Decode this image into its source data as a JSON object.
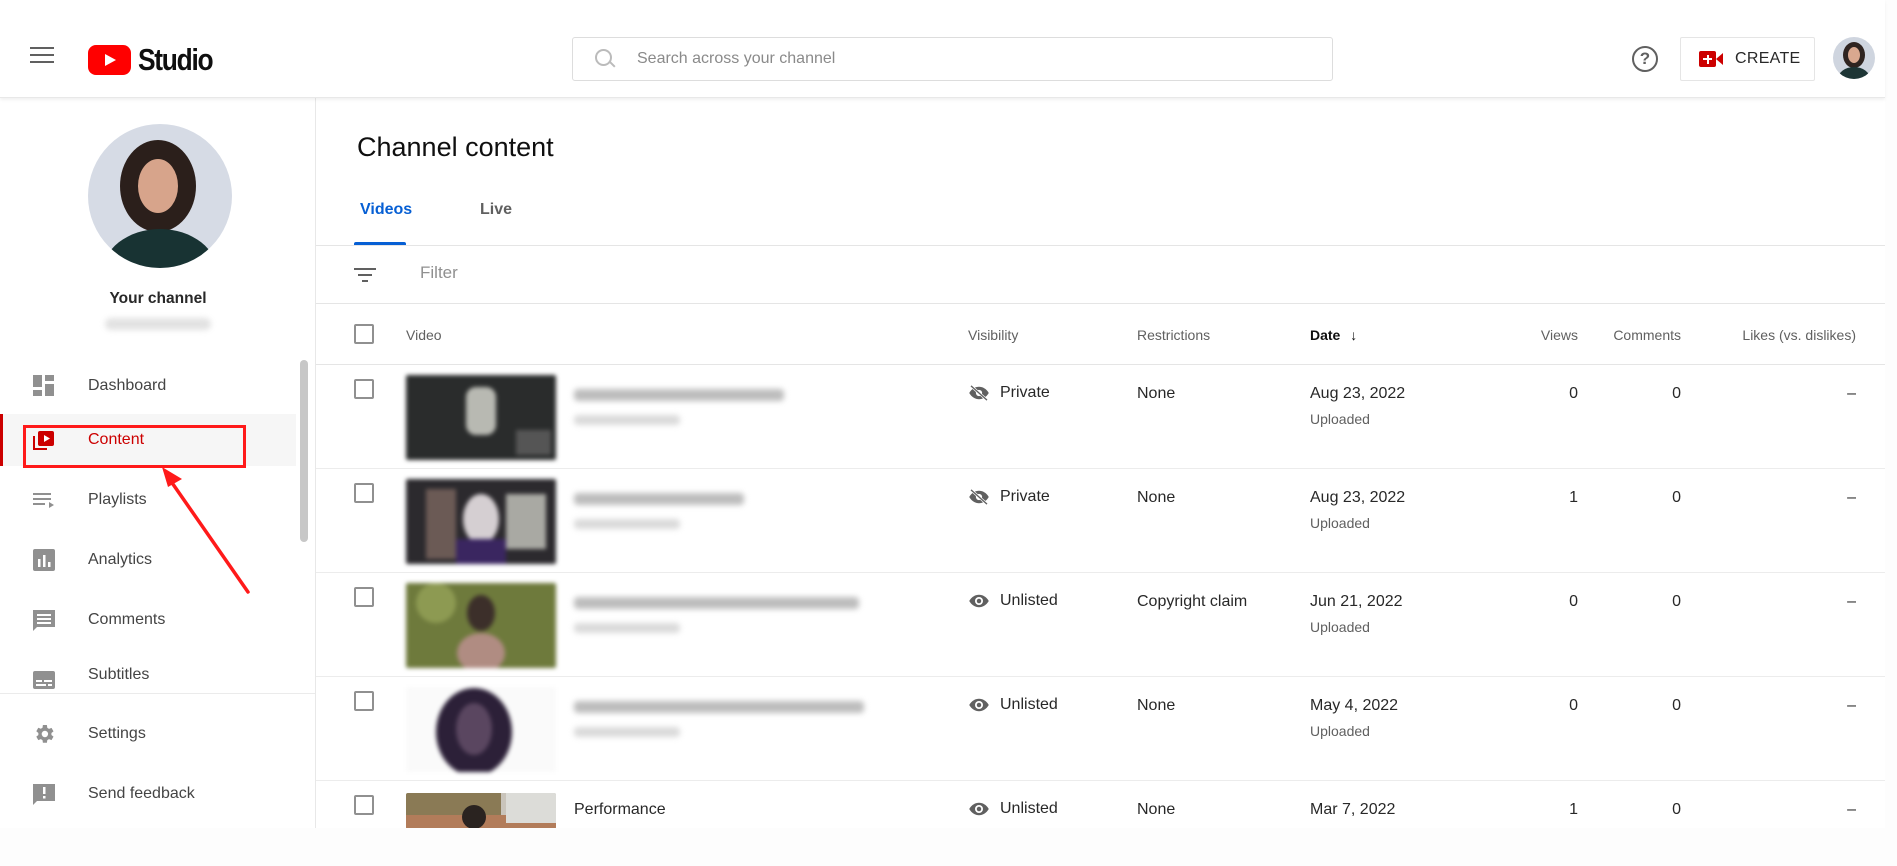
{
  "header": {
    "logo_text": "Studio",
    "search_placeholder": "Search across your channel",
    "help_glyph": "?",
    "create_label": "CREATE"
  },
  "sidebar": {
    "your_channel": "Your channel",
    "items": [
      {
        "label": "Dashboard",
        "icon": "dashboard-icon"
      },
      {
        "label": "Content",
        "icon": "content-icon",
        "active": true
      },
      {
        "label": "Playlists",
        "icon": "playlists-icon"
      },
      {
        "label": "Analytics",
        "icon": "analytics-icon"
      },
      {
        "label": "Comments",
        "icon": "comments-icon"
      },
      {
        "label": "Subtitles",
        "icon": "subtitles-icon"
      }
    ],
    "footer_items": [
      {
        "label": "Settings",
        "icon": "settings-icon"
      },
      {
        "label": "Send feedback",
        "icon": "feedback-icon"
      }
    ]
  },
  "main": {
    "title": "Channel content",
    "tabs": [
      {
        "label": "Videos",
        "active": true
      },
      {
        "label": "Live",
        "active": false
      }
    ],
    "filter_placeholder": "Filter",
    "columns": {
      "video": "Video",
      "visibility": "Visibility",
      "restrictions": "Restrictions",
      "date": "Date",
      "date_sort_glyph": "↓",
      "views": "Views",
      "comments": "Comments",
      "likes": "Likes (vs. dislikes)"
    },
    "rows": [
      {
        "title": "",
        "visibility": "Private",
        "visibility_icon": "eye-off-icon",
        "restrictions": "None",
        "date": "Aug 23, 2022",
        "date_status": "Uploaded",
        "views": "0",
        "comments": "0",
        "likes": "–"
      },
      {
        "title": "",
        "visibility": "Private",
        "visibility_icon": "eye-off-icon",
        "restrictions": "None",
        "date": "Aug 23, 2022",
        "date_status": "Uploaded",
        "views": "1",
        "comments": "0",
        "likes": "–"
      },
      {
        "title": "",
        "visibility": "Unlisted",
        "visibility_icon": "eye-icon",
        "restrictions": "Copyright claim",
        "date": "Jun 21, 2022",
        "date_status": "Uploaded",
        "views": "0",
        "comments": "0",
        "likes": "–"
      },
      {
        "title": "",
        "visibility": "Unlisted",
        "visibility_icon": "eye-icon",
        "restrictions": "None",
        "date": "May 4, 2022",
        "date_status": "Uploaded",
        "views": "0",
        "comments": "0",
        "likes": "–"
      },
      {
        "title": "Performance",
        "visibility": "Unlisted",
        "visibility_icon": "eye-icon",
        "restrictions": "None",
        "date": "Mar 7, 2022",
        "date_status": "",
        "views": "1",
        "comments": "0",
        "likes": "–"
      }
    ]
  },
  "colors": {
    "brand_red": "#ff0000",
    "active_red": "#cc0000",
    "tab_blue": "#065fd4",
    "annotation_red": "#ff1a1a"
  }
}
